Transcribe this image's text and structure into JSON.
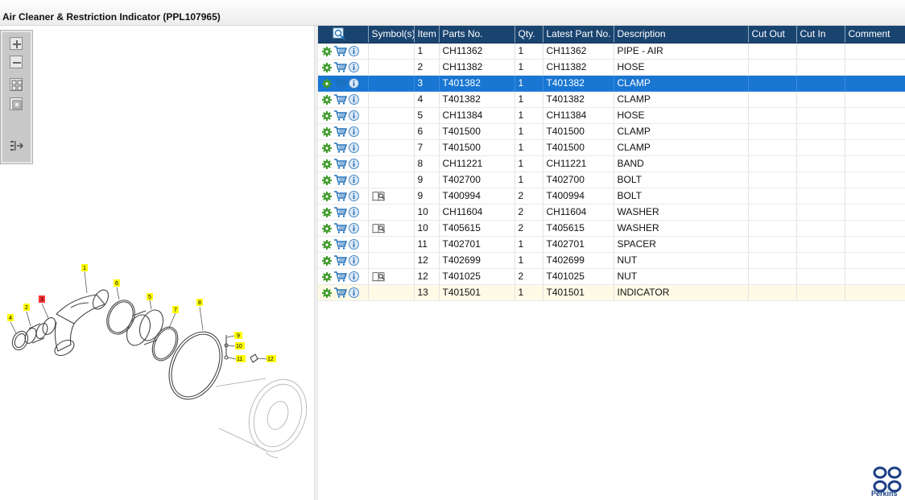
{
  "window": {
    "title": "Air Cleaner & Restriction Indicator (PPL107965)"
  },
  "toolbar": {
    "buttons": [
      {
        "name": "zoom-in-button",
        "icon": "zoom-in-icon"
      },
      {
        "name": "zoom-out-button",
        "icon": "zoom-out-icon"
      },
      {
        "name": "fit-all-button",
        "icon": "fit-all-icon"
      },
      {
        "name": "fit-window-button",
        "icon": "fit-window-icon"
      },
      {
        "name": "export-list-button",
        "icon": "export-list-icon"
      }
    ]
  },
  "diagram": {
    "callouts": [
      "1",
      "2",
      "3",
      "4",
      "5",
      "6",
      "7",
      "8",
      "9",
      "10",
      "11",
      "12"
    ],
    "highlighted_callout": "3",
    "callout_color": "#ffff00",
    "highlight_color": "#ff3333"
  },
  "grid": {
    "columns": [
      "",
      "Symbol(s)",
      "Item",
      "Parts No.",
      "Qty.",
      "Latest Part No.",
      "Description",
      "Cut Out",
      "Cut In",
      "Comment"
    ],
    "header_color": "#1a4470",
    "selected_color": "#1976d2",
    "rows": [
      {
        "symbol": false,
        "item": "1",
        "part": "CH11362",
        "qty": "1",
        "latest": "CH11362",
        "desc": "PIPE - AIR",
        "cutout": "",
        "cutin": "",
        "comment": ""
      },
      {
        "symbol": false,
        "item": "2",
        "part": "CH11382",
        "qty": "1",
        "latest": "CH11382",
        "desc": "HOSE",
        "cutout": "",
        "cutin": "",
        "comment": ""
      },
      {
        "symbol": false,
        "item": "3",
        "part": "T401382",
        "qty": "1",
        "latest": "T401382",
        "desc": "CLAMP",
        "cutout": "",
        "cutin": "",
        "comment": "",
        "selected": true
      },
      {
        "symbol": false,
        "item": "4",
        "part": "T401382",
        "qty": "1",
        "latest": "T401382",
        "desc": "CLAMP",
        "cutout": "",
        "cutin": "",
        "comment": ""
      },
      {
        "symbol": false,
        "item": "5",
        "part": "CH11384",
        "qty": "1",
        "latest": "CH11384",
        "desc": "HOSE",
        "cutout": "",
        "cutin": "",
        "comment": ""
      },
      {
        "symbol": false,
        "item": "6",
        "part": "T401500",
        "qty": "1",
        "latest": "T401500",
        "desc": "CLAMP",
        "cutout": "",
        "cutin": "",
        "comment": ""
      },
      {
        "symbol": false,
        "item": "7",
        "part": "T401500",
        "qty": "1",
        "latest": "T401500",
        "desc": "CLAMP",
        "cutout": "",
        "cutin": "",
        "comment": ""
      },
      {
        "symbol": false,
        "item": "8",
        "part": "CH11221",
        "qty": "1",
        "latest": "CH11221",
        "desc": "BAND",
        "cutout": "",
        "cutin": "",
        "comment": ""
      },
      {
        "symbol": false,
        "item": "9",
        "part": "T402700",
        "qty": "1",
        "latest": "T402700",
        "desc": "BOLT",
        "cutout": "",
        "cutin": "",
        "comment": ""
      },
      {
        "symbol": true,
        "item": "9",
        "part": "T400994",
        "qty": "2",
        "latest": "T400994",
        "desc": "BOLT",
        "cutout": "",
        "cutin": "",
        "comment": ""
      },
      {
        "symbol": false,
        "item": "10",
        "part": "CH11604",
        "qty": "2",
        "latest": "CH11604",
        "desc": "WASHER",
        "cutout": "",
        "cutin": "",
        "comment": ""
      },
      {
        "symbol": true,
        "item": "10",
        "part": "T405615",
        "qty": "2",
        "latest": "T405615",
        "desc": "WASHER",
        "cutout": "",
        "cutin": "",
        "comment": ""
      },
      {
        "symbol": false,
        "item": "11",
        "part": "T402701",
        "qty": "1",
        "latest": "T402701",
        "desc": "SPACER",
        "cutout": "",
        "cutin": "",
        "comment": ""
      },
      {
        "symbol": false,
        "item": "12",
        "part": "T402699",
        "qty": "1",
        "latest": "T402699",
        "desc": "NUT",
        "cutout": "",
        "cutin": "",
        "comment": ""
      },
      {
        "symbol": true,
        "item": "12",
        "part": "T401025",
        "qty": "2",
        "latest": "T401025",
        "desc": "NUT",
        "cutout": "",
        "cutin": "",
        "comment": ""
      },
      {
        "symbol": false,
        "item": "13",
        "part": "T401501",
        "qty": "1",
        "latest": "T401501",
        "desc": "INDICATOR",
        "cutout": "",
        "cutin": "",
        "comment": "",
        "last": true
      }
    ],
    "row_icons": [
      "gear-icon",
      "cart-icon",
      "info-icon"
    ],
    "symbol_icon": "book-search-icon"
  },
  "brand": {
    "name": "Perkins",
    "color": "#1b3f86"
  }
}
